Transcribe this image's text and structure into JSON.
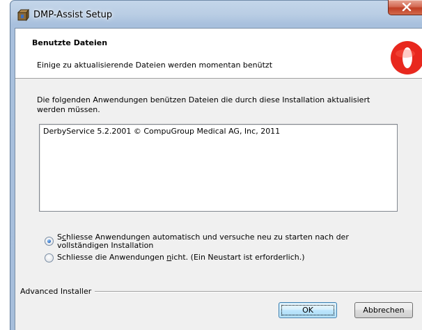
{
  "window": {
    "title": "DMP-Assist Setup"
  },
  "banner": {
    "title": "Benutzte Dateien",
    "subtitle": "Einige zu aktualisierende Dateien werden momentan benützt",
    "logo_color": "#e8281e"
  },
  "main": {
    "description": "Die folgenden Anwendungen benützen Dateien die durch diese Installation aktualisiert werden müssen.",
    "applications": [
      "DerbyService 5.2.2001 © CompuGroup Medical AG, Inc, 2011"
    ],
    "options": [
      {
        "prefix": "S",
        "mnemonic": "c",
        "rest_line1": "hliesse Anwendungen automatisch und versuche neu zu starten nach der",
        "line2": "vollständigen Installation",
        "selected": true
      },
      {
        "before": "Schliesse die Anwendungen ",
        "mnemonic": "n",
        "after": "icht. (Ein Neustart ist erforderlich.)",
        "selected": false
      }
    ]
  },
  "footer": {
    "group_label": "Advanced Installer",
    "ok_label": "OK",
    "cancel_label": "Abbrechen"
  },
  "icons": {
    "app": "installer-box-icon",
    "close": "close-icon",
    "logo": "red-circle-logo"
  },
  "colors": {
    "close_button": "#c13f25",
    "default_button_border": "#3c7fb1"
  }
}
